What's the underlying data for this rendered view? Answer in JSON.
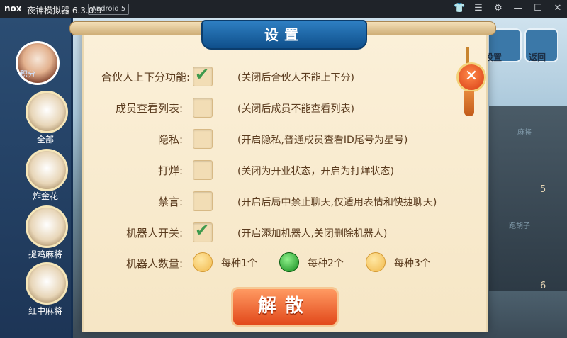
{
  "titlebar": {
    "logo": "nox",
    "title": "夜神模拟器 6.3.0.9",
    "android_badge": "Android 5",
    "icons": [
      "shirt-icon",
      "menu-icon",
      "gear-icon",
      "minimize-icon",
      "maximize-icon",
      "close-icon"
    ]
  },
  "background": {
    "left_tab": "积分",
    "games": [
      "全部",
      "炸金花",
      "捉鸡麻将",
      "红中麻将"
    ],
    "top_buttons": [
      "设置",
      "返回"
    ],
    "tables": [
      {
        "label": "麻将",
        "num": "5"
      },
      {
        "label": "跑胡子",
        "num": "6"
      }
    ]
  },
  "dialog": {
    "title": "设置",
    "rows": [
      {
        "label": "合伙人上下分功能:",
        "checked": true,
        "desc": "(关闭后合伙人不能上下分)"
      },
      {
        "label": "成员查看列表:",
        "checked": false,
        "desc": "(关闭后成员不能查看列表)"
      },
      {
        "label": "隐私:",
        "checked": false,
        "desc": "(开启隐私,普通成员查看ID尾号为星号)"
      },
      {
        "label": "打烊:",
        "checked": false,
        "desc": "(关闭为开业状态，开启为打烊状态)"
      },
      {
        "label": "禁言:",
        "checked": false,
        "desc": "(开启后局中禁止聊天,仅适用表情和快捷聊天)"
      },
      {
        "label": "机器人开关:",
        "checked": true,
        "desc": "(开启添加机器人,关闭删除机器人)"
      }
    ],
    "robot_count": {
      "label": "机器人数量:",
      "options": [
        "每种1个",
        "每种2个",
        "每种3个"
      ],
      "selected": "每种2个"
    },
    "dissolve_button": "解散",
    "close_symbol": "✕"
  }
}
